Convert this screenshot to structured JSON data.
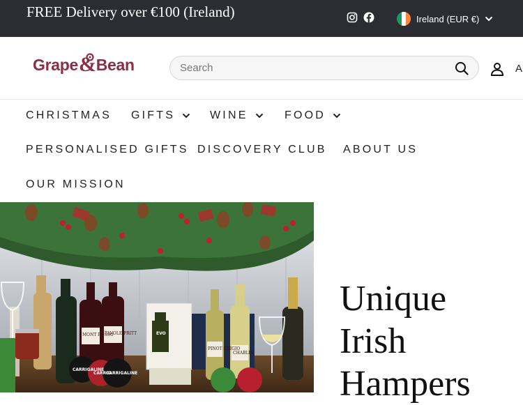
{
  "announcement": {
    "promo_text": "FREE Delivery over €100 (Ireland)",
    "social_icons": [
      "instagram-icon",
      "facebook-icon"
    ],
    "region": {
      "label": "Ireland (EUR €)",
      "flag": "ireland-flag-icon",
      "flag_colors": [
        "#169b62",
        "#ffffff",
        "#ff883e"
      ]
    }
  },
  "header": {
    "logo_text_left": "Grape",
    "logo_amp": "&",
    "logo_text_right": "Bean",
    "brand_color": "#8b2f46",
    "search": {
      "placeholder": "Search",
      "value": ""
    },
    "account_text": "A"
  },
  "nav": {
    "items": [
      {
        "label": "CHRISTMAS",
        "has_dropdown": false
      },
      {
        "label": "GIFTS",
        "has_dropdown": true
      },
      {
        "label": "WINE",
        "has_dropdown": true
      },
      {
        "label": "FOOD",
        "has_dropdown": true
      },
      {
        "label": "PERSONALISED GIFTS",
        "has_dropdown": false
      },
      {
        "label": "DISCOVERY CLUB",
        "has_dropdown": false
      },
      {
        "label": "ABOUT US",
        "has_dropdown": false
      },
      {
        "label": "OUR MISSION",
        "has_dropdown": false
      }
    ]
  },
  "hero": {
    "title_lines": [
      "Unique",
      "Irish",
      "Hampers"
    ],
    "image_labels": {
      "wine_label": "MONT ROSSO",
      "wine_label_2": "TAVOLE PRITT",
      "oil_label": "EVO",
      "white_label": "PINOT GRIGIO",
      "chablis": "CHABLIS",
      "cheese_1": "CARRIGALINE",
      "cheese_2": "CARRIG",
      "cheese_3": "CARRIGALINE"
    }
  }
}
